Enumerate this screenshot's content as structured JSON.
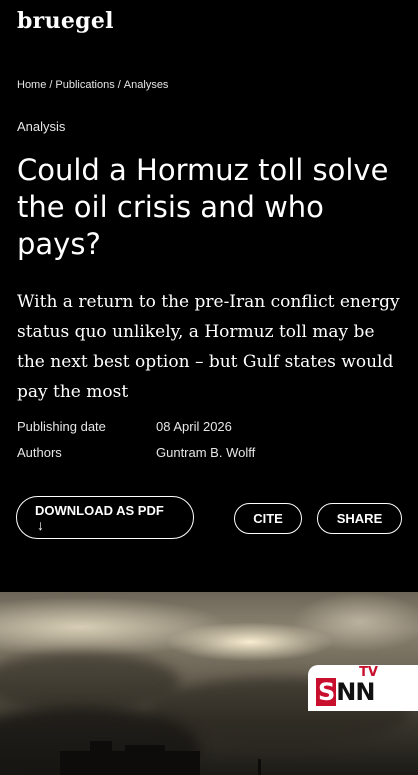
{
  "site": {
    "logo": "bruegel"
  },
  "breadcrumb": [
    {
      "label": "Home"
    },
    {
      "label": "Publications"
    },
    {
      "label": "Analyses"
    }
  ],
  "breadcrumb_separator": "/",
  "article": {
    "category": "Analysis",
    "title": "Could a Hormuz toll solve the oil crisis and who pays?",
    "subtitle": "With a return to the pre-Iran conflict energy status quo unlikely, a Hormuz toll may be the next best option – but Gulf states would pay the most",
    "meta": {
      "publishing_date_label": "Publishing date",
      "publishing_date": "08 April 2026",
      "authors_label": "Authors",
      "authors": "Guntram B. Wolff"
    }
  },
  "actions": {
    "download_pdf": "DOWNLOAD AS PDF",
    "download_arrow": "↓",
    "cite": "CITE",
    "share": "SHARE"
  },
  "hero_image": {
    "watermark_main_s": "S",
    "watermark_main_rest": "NN",
    "watermark_tv": "TV",
    "brand_color": "#c8102e"
  }
}
